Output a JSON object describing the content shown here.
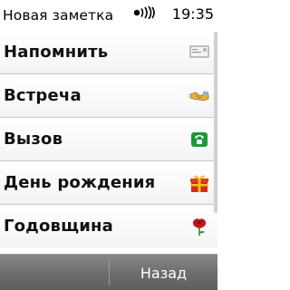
{
  "status_bar": {
    "title": "Новая заметка",
    "time": "19:35",
    "signal_icon": "broadcast-signal-icon"
  },
  "menu": {
    "items": [
      {
        "label": "Напомнить",
        "icon": "envelope-icon"
      },
      {
        "label": "Встреча",
        "icon": "handshake-icon"
      },
      {
        "label": "Вызов",
        "icon": "phone-icon"
      },
      {
        "label": "День рождения",
        "icon": "gift-icon"
      },
      {
        "label": "Годовщина",
        "icon": "rose-icon"
      }
    ]
  },
  "softkeys": {
    "right_label": "Назад"
  },
  "colors": {
    "softkey_bar": "#6e6e6e",
    "phone_green": "#1a9a3a",
    "gift_red": "#d8281c",
    "gift_yellow": "#f2c418"
  }
}
